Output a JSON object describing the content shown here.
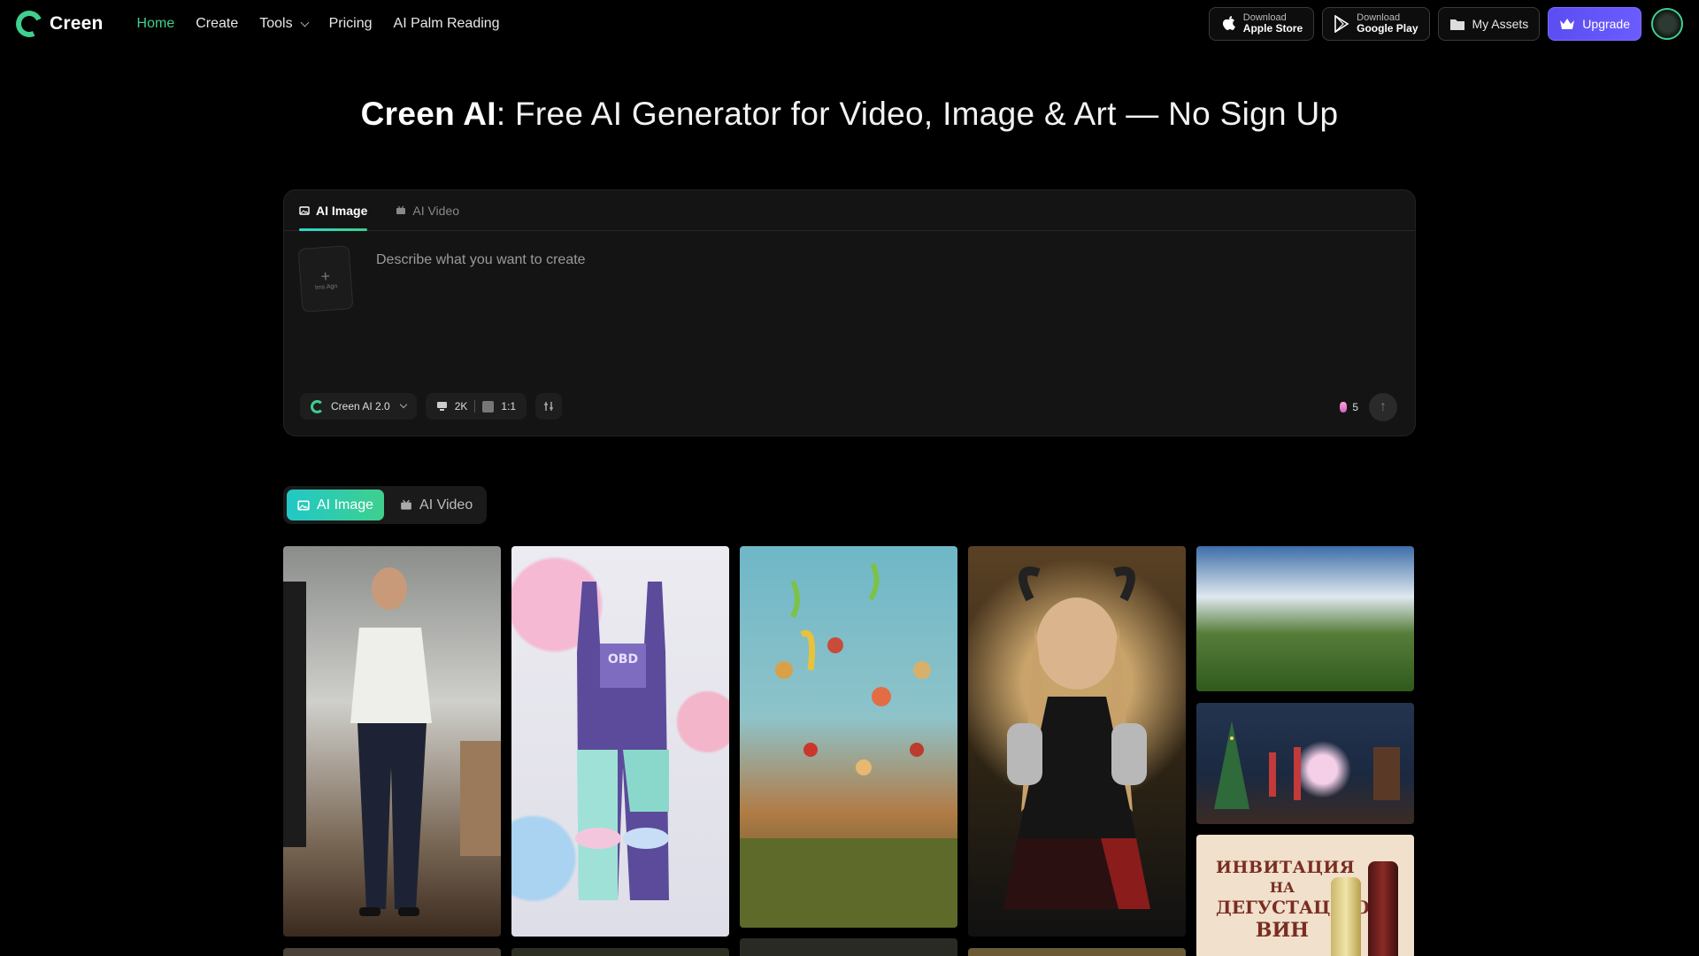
{
  "header": {
    "brand": "Creen",
    "nav": [
      {
        "label": "Home",
        "active": true
      },
      {
        "label": "Create"
      },
      {
        "label": "Tools",
        "has_dropdown": true
      },
      {
        "label": "Pricing"
      },
      {
        "label": "AI Palm Reading"
      }
    ],
    "apple": {
      "small": "Download",
      "big": "Apple Store"
    },
    "google": {
      "small": "Download",
      "big": "Google Play"
    },
    "my_assets": "My Assets",
    "upgrade": "Upgrade"
  },
  "hero": {
    "brand": "Creen AI",
    "rest": ": Free AI Generator for Video, Image & Art — No Sign Up"
  },
  "prompt_card": {
    "tabs": [
      {
        "label": "AI Image",
        "icon": "image-icon",
        "active": true
      },
      {
        "label": "AI Video",
        "icon": "video-icon"
      }
    ],
    "upload_label": "Ims Agn",
    "placeholder": "Describe what you want to create",
    "model": "Creen AI 2.0",
    "resolution": "2K",
    "ratio": "1:1",
    "credits": "5"
  },
  "gallery": {
    "tabs": [
      {
        "label": "AI Image",
        "active": true
      },
      {
        "label": "AI Video"
      }
    ],
    "invite_lines": [
      "ИНВИТАЦИЯ",
      "НА",
      "ДЕГУСТАЦИЮ",
      "ВИН"
    ],
    "overalls_text": "OBD"
  },
  "colors": {
    "accent": "#3fcf8e",
    "upgrade": "#5b4df0",
    "background": "#000000",
    "card": "#141414"
  }
}
